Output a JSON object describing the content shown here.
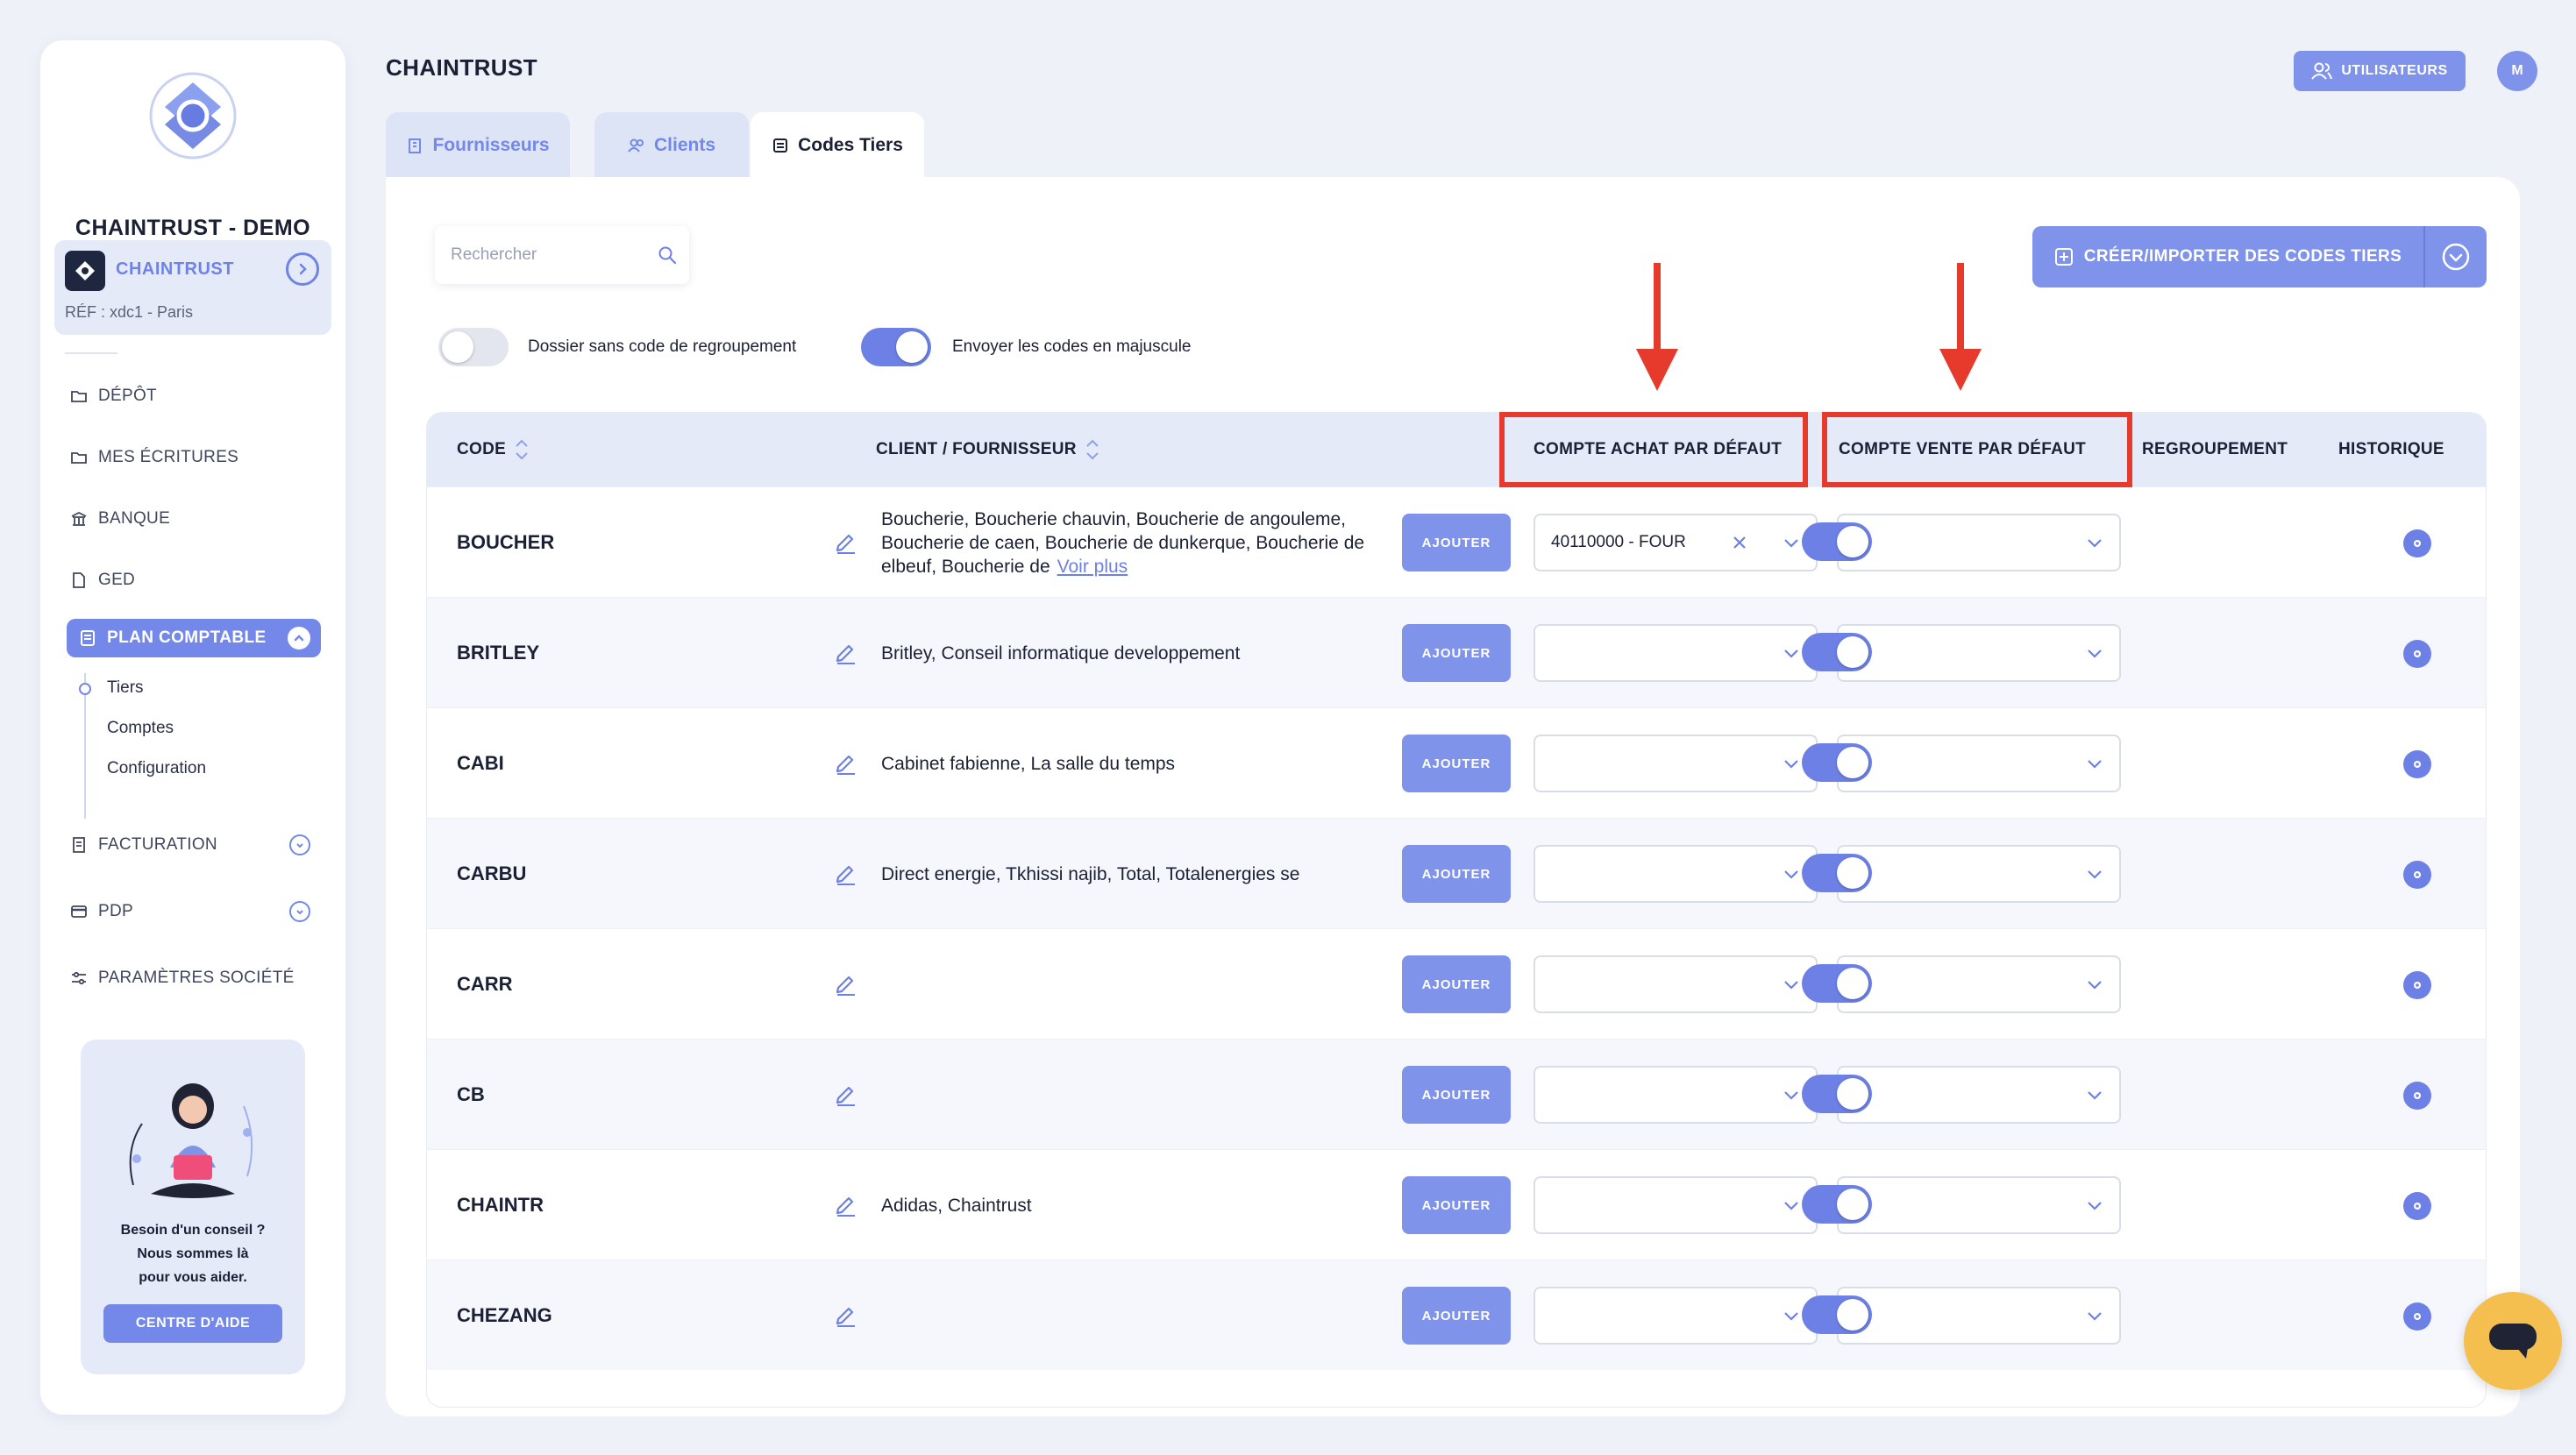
{
  "sidebar": {
    "company_name": "CHAINTRUST - DEMO",
    "org": {
      "name": "CHAINTRUST",
      "ref": "RÉF : xdc1 - Paris"
    },
    "nav": [
      {
        "label": "DÉPÔT",
        "icon": "folder-icon"
      },
      {
        "label": "MES ÉCRITURES",
        "icon": "folder-icon"
      },
      {
        "label": "BANQUE",
        "icon": "bank-icon"
      },
      {
        "label": "GED",
        "icon": "document-icon"
      }
    ],
    "active_section": "PLAN COMPTABLE",
    "sub_items": [
      "Tiers",
      "Comptes",
      "Configuration"
    ],
    "nav_bottom": [
      {
        "label": "FACTURATION",
        "icon": "invoice-icon",
        "expandable": true
      },
      {
        "label": "PDP",
        "icon": "card-icon",
        "expandable": true
      },
      {
        "label": "PARAMÈTRES SOCIÉTÉ",
        "icon": "sliders-icon",
        "expandable": false
      }
    ],
    "help": {
      "line1": "Besoin d'un conseil ?",
      "line2": "Nous sommes là",
      "line3": "pour vous aider.",
      "button": "CENTRE D'AIDE"
    }
  },
  "header": {
    "title": "CHAINTRUST",
    "users_button": "UTILISATEURS",
    "avatar_initial": "M"
  },
  "tabs": [
    {
      "label": "Fournisseurs",
      "icon": "building-icon",
      "active": false
    },
    {
      "label": "Clients",
      "icon": "users-icon",
      "active": false
    },
    {
      "label": "Codes Tiers",
      "icon": "list-icon",
      "active": true
    }
  ],
  "toolbar": {
    "search_placeholder": "Rechercher",
    "toggle1_label": "Dossier sans code de regroupement",
    "toggle1_on": false,
    "toggle2_label": "Envoyer les codes en majuscule",
    "toggle2_on": true,
    "create_button": "CRÉER/IMPORTER DES CODES TIERS"
  },
  "table": {
    "columns": {
      "code": "CODE",
      "client": "CLIENT / FOURNISSEUR",
      "achat": "COMPTE ACHAT PAR DÉFAUT",
      "vente": "COMPTE VENTE PAR DÉFAUT",
      "regroupement": "REGROUPEMENT",
      "historique": "HISTORIQUE"
    },
    "add_label": "AJOUTER",
    "voir_plus": "Voir plus",
    "rows": [
      {
        "code": "BOUCHER",
        "clients": "Boucherie, Boucherie chauvin, Boucherie de angouleme, Boucherie de caen, Boucherie de dunkerque, Boucherie de elbeuf, Boucherie de",
        "achat": "40110000 - FOUR",
        "vente": "",
        "regroupement": true
      },
      {
        "code": "BRITLEY",
        "clients": "Britley, Conseil informatique developpement",
        "achat": "",
        "vente": "",
        "regroupement": true
      },
      {
        "code": "CABI",
        "clients": "Cabinet fabienne, La salle du temps",
        "achat": "",
        "vente": "",
        "regroupement": true
      },
      {
        "code": "CARBU",
        "clients": "Direct energie, Tkhissi najib, Total, Totalenergies se",
        "achat": "",
        "vente": "",
        "regroupement": true
      },
      {
        "code": "CARR",
        "clients": "",
        "achat": "",
        "vente": "",
        "regroupement": true
      },
      {
        "code": "CB",
        "clients": "",
        "achat": "",
        "vente": "",
        "regroupement": true
      },
      {
        "code": "CHAINTR",
        "clients": "Adidas, Chaintrust",
        "achat": "",
        "vente": "",
        "regroupement": true
      },
      {
        "code": "CHEZANG",
        "clients": "",
        "achat": "",
        "vente": "",
        "regroupement": true
      }
    ]
  },
  "colors": {
    "accent": "#7388e8",
    "highlight": "#e53a2c",
    "chat": "#f4bf4f"
  }
}
